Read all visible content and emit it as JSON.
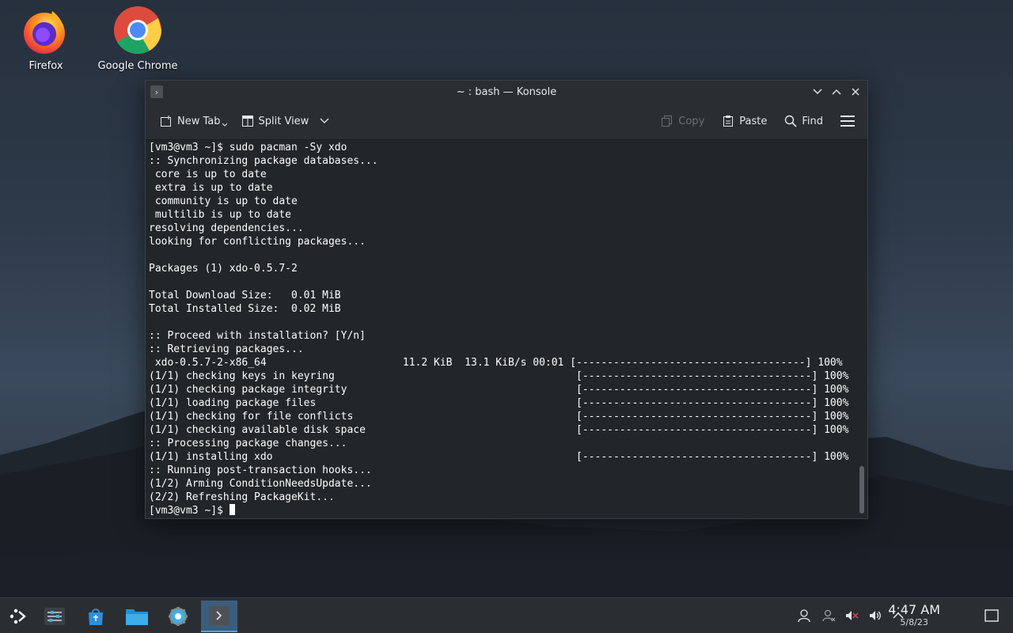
{
  "desktop": {
    "icons": [
      {
        "label": "Firefox"
      },
      {
        "label": "Google Chrome"
      }
    ]
  },
  "window": {
    "title": "~ : bash — Konsole",
    "toolbar": {
      "new_tab": "New Tab",
      "split_view": "Split View",
      "copy": "Copy",
      "paste": "Paste",
      "find": "Find"
    },
    "terminal_lines": [
      "[vm3@vm3 ~]$ sudo pacman -Sy xdo",
      ":: Synchronizing package databases...",
      " core is up to date",
      " extra is up to date",
      " community is up to date",
      " multilib is up to date",
      "resolving dependencies...",
      "looking for conflicting packages...",
      "",
      "Packages (1) xdo-0.5.7-2",
      "",
      "Total Download Size:   0.01 MiB",
      "Total Installed Size:  0.02 MiB",
      "",
      ":: Proceed with installation? [Y/n]",
      ":: Retrieving packages...",
      " xdo-0.5.7-2-x86_64                      11.2 KiB  13.1 KiB/s 00:01 [-------------------------------------] 100%",
      "(1/1) checking keys in keyring                                       [-------------------------------------] 100%",
      "(1/1) checking package integrity                                     [-------------------------------------] 100%",
      "(1/1) loading package files                                          [-------------------------------------] 100%",
      "(1/1) checking for file conflicts                                    [-------------------------------------] 100%",
      "(1/1) checking available disk space                                  [-------------------------------------] 100%",
      ":: Processing package changes...",
      "(1/1) installing xdo                                                 [-------------------------------------] 100%",
      ":: Running post-transaction hooks...",
      "(1/2) Arming ConditionNeedsUpdate...",
      "(2/2) Refreshing PackageKit...",
      "[vm3@vm3 ~]$ "
    ]
  },
  "taskbar": {
    "clock_time": "4:47 AM",
    "clock_date": "5/8/23"
  },
  "colors": {
    "accent": "#3daee9",
    "terminal_bg": "#232629",
    "terminal_fg": "#fcfcfc"
  }
}
